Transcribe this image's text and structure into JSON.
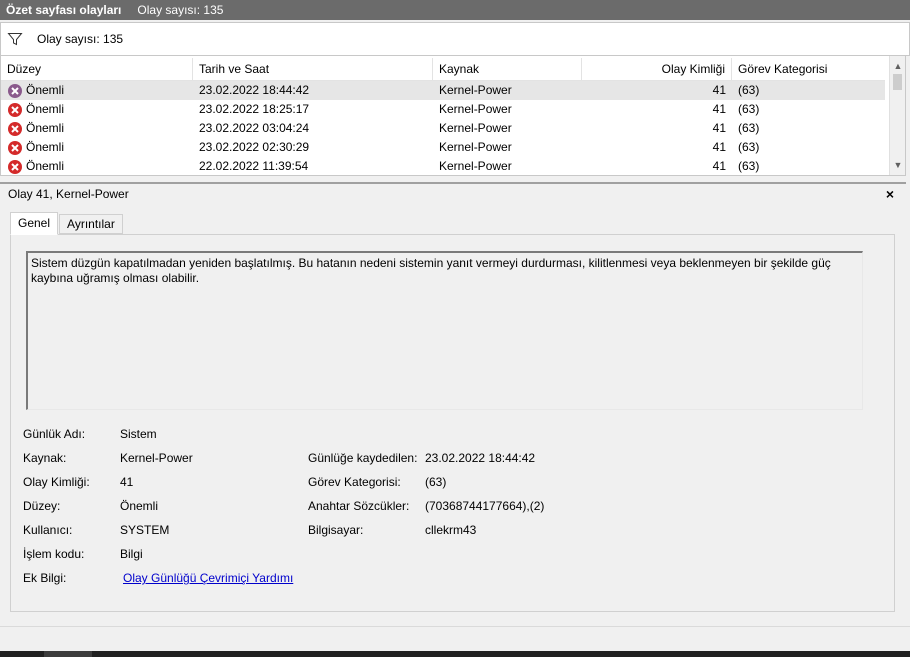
{
  "header": {
    "title": "Özet sayfası olayları",
    "count": "Olay sayısı: 135"
  },
  "filter": {
    "label": "Olay sayısı: 135"
  },
  "table": {
    "columns": [
      "Düzey",
      "Tarih ve Saat",
      "Kaynak",
      "Olay Kimliği",
      "Görev Kategorisi"
    ],
    "rows": [
      {
        "level": "Önemli",
        "datetime": "23.02.2022 18:44:42",
        "source": "Kernel-Power",
        "id": "41",
        "category": "(63)"
      },
      {
        "level": "Önemli",
        "datetime": "23.02.2022 18:25:17",
        "source": "Kernel-Power",
        "id": "41",
        "category": "(63)"
      },
      {
        "level": "Önemli",
        "datetime": "23.02.2022 03:04:24",
        "source": "Kernel-Power",
        "id": "41",
        "category": "(63)"
      },
      {
        "level": "Önemli",
        "datetime": "23.02.2022 02:30:29",
        "source": "Kernel-Power",
        "id": "41",
        "category": "(63)"
      },
      {
        "level": "Önemli",
        "datetime": "22.02.2022 11:39:54",
        "source": "Kernel-Power",
        "id": "41",
        "category": "(63)"
      }
    ]
  },
  "detail": {
    "title": "Olay 41, Kernel-Power",
    "close": "×",
    "tabs": [
      "Genel",
      "Ayrıntılar"
    ],
    "message": "Sistem düzgün kapatılmadan yeniden başlatılmış. Bu hatanın nedeni sistemin yanıt vermeyi durdurması, kilitlenmesi veya beklenmeyen bir şekilde güç kaybına uğramış olması olabilir.",
    "fields": {
      "log_name": {
        "label": "Günlük Adı:",
        "value": "Sistem"
      },
      "source": {
        "label": "Kaynak:",
        "value": "Kernel-Power"
      },
      "event_id": {
        "label": "Olay Kimliği:",
        "value": "41"
      },
      "level": {
        "label": "Düzey:",
        "value": "Önemli"
      },
      "user": {
        "label": "Kullanıcı:",
        "value": "SYSTEM"
      },
      "opcode": {
        "label": "İşlem kodu:",
        "value": "Bilgi"
      },
      "more_info": {
        "label": "Ek Bilgi:",
        "value": "Olay Günlüğü Çevrimiçi Yardımı"
      },
      "logged": {
        "label": "Günlüğe kaydedilen:",
        "value": "23.02.2022 18:44:42"
      },
      "task_category": {
        "label": "Görev Kategorisi:",
        "value": "(63)"
      },
      "keywords": {
        "label": "Anahtar Sözcükler:",
        "value": "(70368744177664),(2)"
      },
      "computer": {
        "label": "Bilgisayar:",
        "value": "cllekrm43"
      }
    }
  },
  "colors": {
    "header_bg": "#6b6b6b",
    "error_red": "#d42a2a",
    "selected_row": "#e6e6e6",
    "link": "#0000cc"
  }
}
